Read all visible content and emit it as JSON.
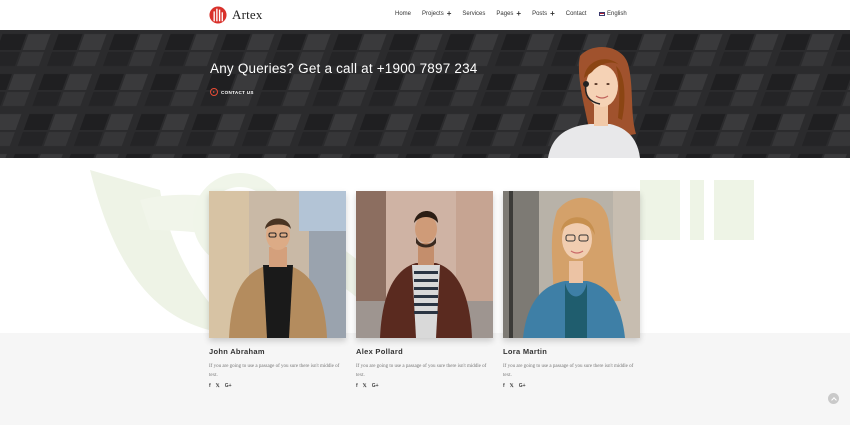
{
  "header": {
    "brand": "Artex",
    "nav": [
      {
        "label": "Home",
        "has_submenu": false
      },
      {
        "label": "Projects",
        "has_submenu": true
      },
      {
        "label": "Services",
        "has_submenu": false
      },
      {
        "label": "Pages",
        "has_submenu": true
      },
      {
        "label": "Posts",
        "has_submenu": true
      },
      {
        "label": "Contact",
        "has_submenu": false
      }
    ],
    "language": "English",
    "language_icon": "us-flag-icon"
  },
  "banner": {
    "headline": "Any Queries? Get a call at +1900 7897 234",
    "cta_label": "CONTACT US"
  },
  "team": [
    {
      "name": "John Abraham",
      "bio": "If you are going to use a passage of you sure there isn't middle of text."
    },
    {
      "name": "Alex Pollard",
      "bio": "If you are going to use a passage of you sure there isn't middle of text."
    },
    {
      "name": "Lora Martin",
      "bio": "If you are going to use a passage of you sure there isn't middle of text."
    }
  ],
  "social_icons": [
    "facebook-icon",
    "x-icon",
    "google-plus-icon"
  ],
  "colors": {
    "accent": "#e94b35",
    "banner_bg": "#2d2d2f",
    "lower_band": "#f6f6f6"
  }
}
